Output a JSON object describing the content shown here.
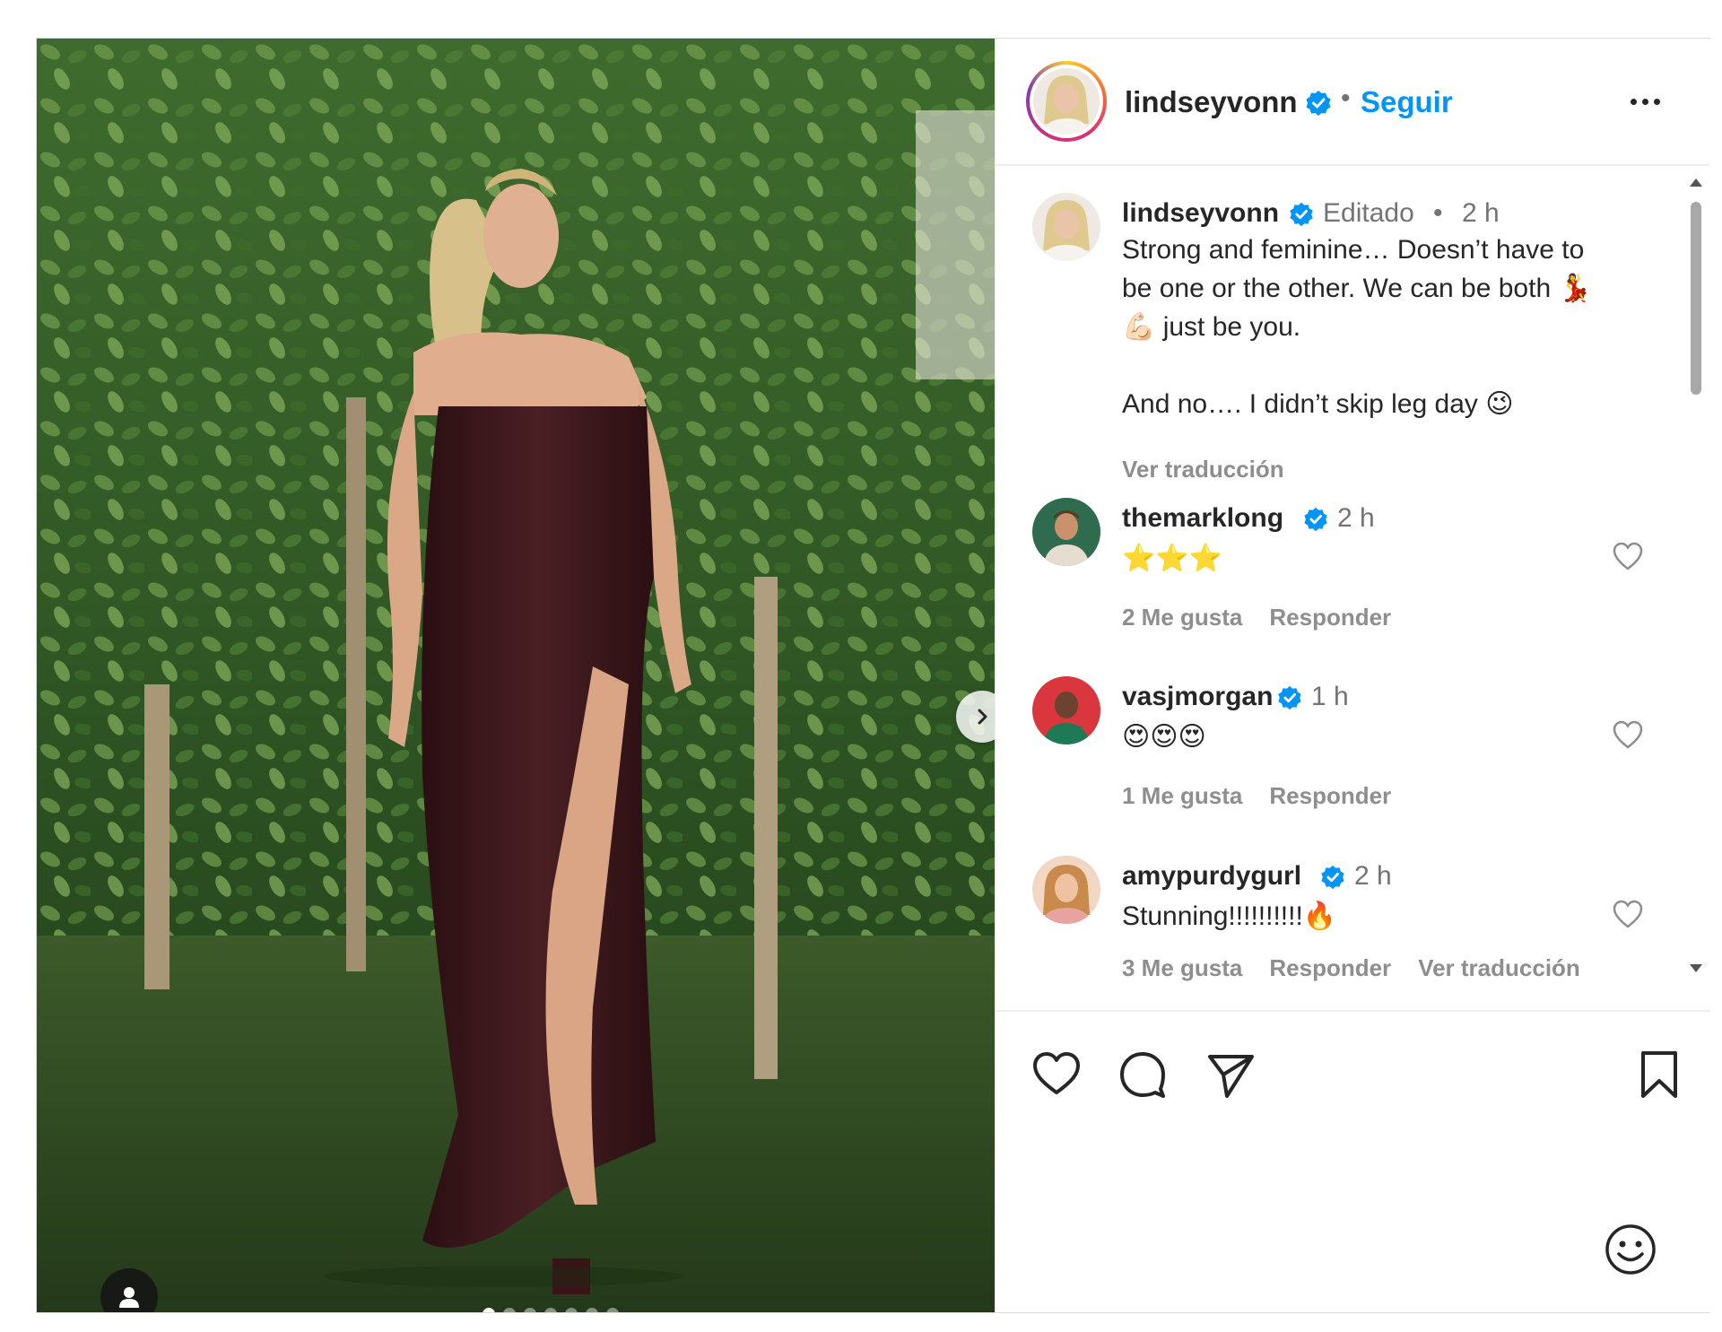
{
  "post": {
    "author": {
      "username": "lindseyvonn",
      "verified": true,
      "follow_label": "Seguir",
      "separator": "•"
    },
    "caption": {
      "username": "lindseyvonn",
      "edited_label": "Editado",
      "dot": "•",
      "time": "2 h",
      "line1": "Strong and feminine…  Doesn’t have to",
      "line2": "be one or the other. We can be both 💃",
      "line3": "💪🏻 just be you.",
      "line4": "And no…. I didn’t skip leg day 😉",
      "translate_label": "Ver traducción"
    },
    "comments": [
      {
        "username": "themarklong",
        "time": "2 h",
        "text": "⭐⭐⭐",
        "likes": "2 Me gusta",
        "reply": "Responder",
        "translate": ""
      },
      {
        "username": "vasjmorgan",
        "time": "1 h",
        "text": "😍😍😍",
        "likes": "1 Me gusta",
        "reply": "Responder",
        "translate": ""
      },
      {
        "username": "amypurdygurl",
        "time": "2 h",
        "text": "Stunning!!!!!!!!!!🔥",
        "likes": "3 Me gusta",
        "reply": "Responder",
        "translate": "Ver traducción"
      }
    ],
    "carousel": {
      "count": 7,
      "active": 0
    }
  },
  "icons": {
    "verified": "verified-badge-icon",
    "more": "more-options-icon",
    "like": "heart-icon",
    "comment": "comment-icon",
    "share": "send-icon",
    "save": "bookmark-icon",
    "emoji": "emoji-icon",
    "next": "chevron-right-icon",
    "tag": "user-tag-icon"
  },
  "colors": {
    "accent": "#0095f6",
    "verified": "#0095f6",
    "muted": "#737373",
    "text": "#262626"
  }
}
